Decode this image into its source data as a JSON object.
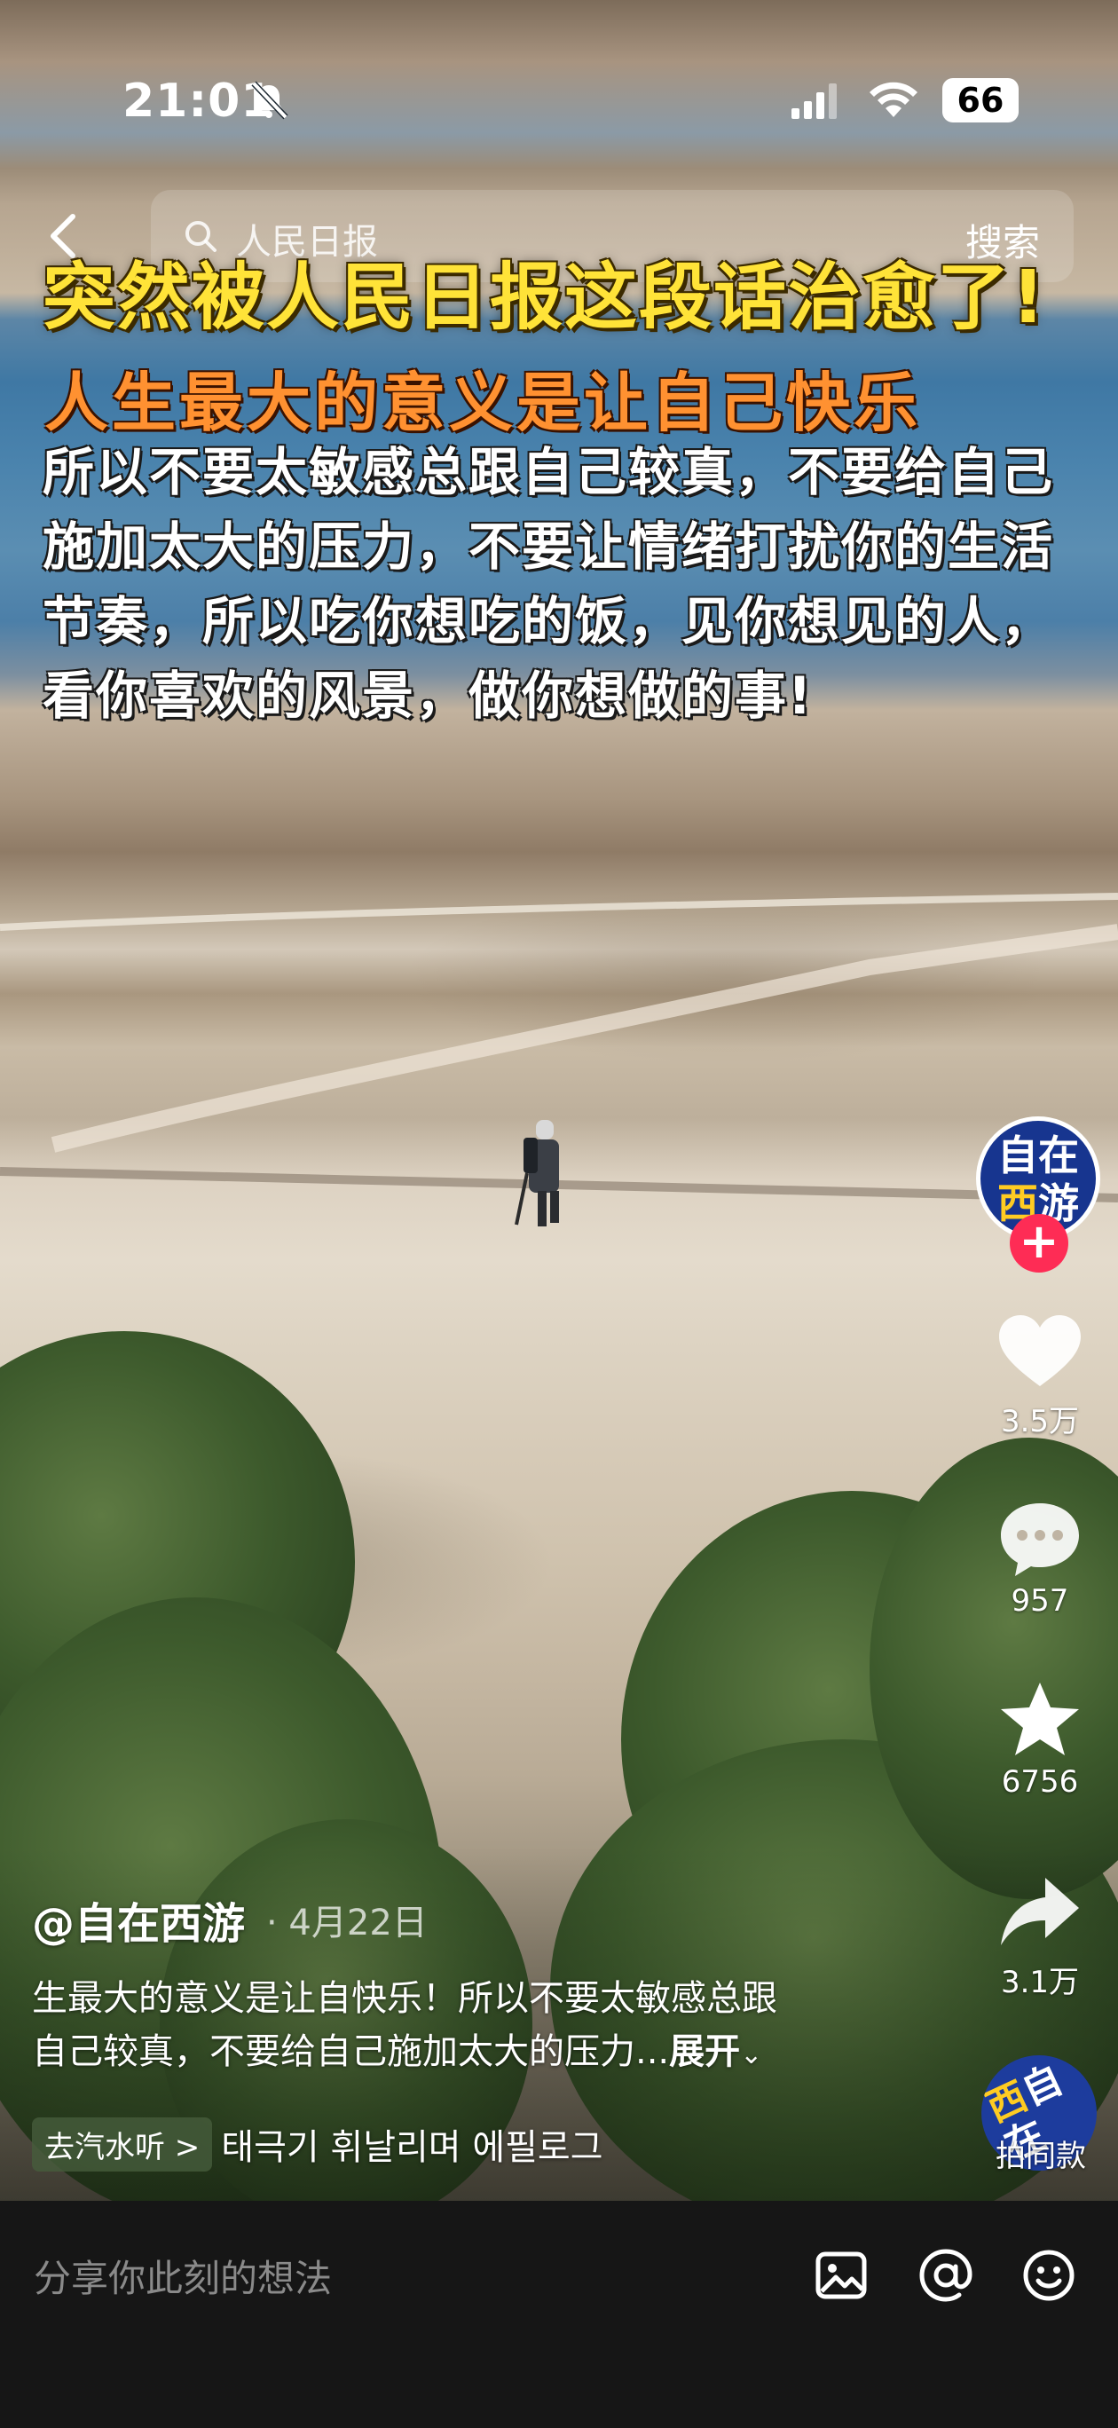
{
  "status_bar": {
    "time": "21:01",
    "battery": "66"
  },
  "search": {
    "placeholder": "人民日报",
    "button": "搜索"
  },
  "overlay": {
    "headline": "突然被人民日报这段话治愈了!",
    "subhead": "人生最大的意义是让自己快乐",
    "paragraph": "所以不要太敏感总跟自己较真，不要给自己施加太大的压力，不要让情绪打扰你的生活节奏，所以吃你想吃的饭，见你想见的人，看你喜欢的风景，做你想做的事!"
  },
  "creator": {
    "avatar_line1": "自在",
    "avatar_line2a": "西",
    "avatar_line2b": "游",
    "follow": "+"
  },
  "actions": {
    "likes": "3.5万",
    "comments": "957",
    "favorites": "6756",
    "shares": "3.1万"
  },
  "post": {
    "author": "@自在西游",
    "date": "· 4月22日",
    "caption_line1": "生最大的意义是让自快乐！所以不要太敏感总跟",
    "caption_line2": "自己较真，不要给自己施加太大的压力...",
    "expand": "展开"
  },
  "music": {
    "chip": "去汽水听 >",
    "title": "태극기 휘날리며 에필로그",
    "disc_line1a": "西",
    "disc_line1b": "自在",
    "same_label": "拍同款"
  },
  "comment_bar": {
    "placeholder": "分享你此刻的想法"
  },
  "icons": [
    "mute-icon",
    "signal-icon",
    "wifi-icon",
    "battery-icon",
    "back-icon",
    "search-icon",
    "heart-icon",
    "comment-icon",
    "star-icon",
    "share-icon",
    "image-icon",
    "mention-icon",
    "emoji-icon"
  ]
}
